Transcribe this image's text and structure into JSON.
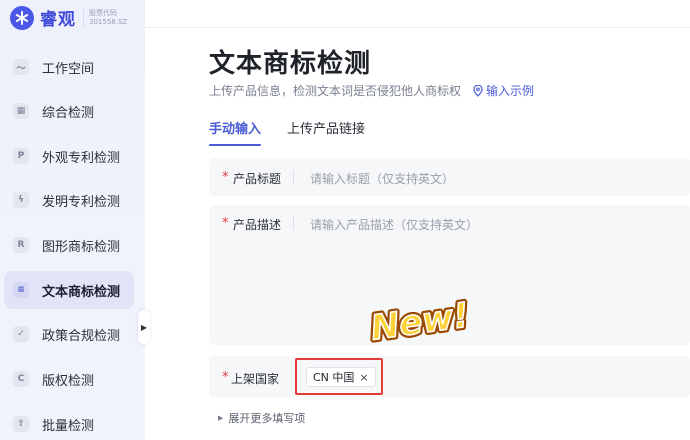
{
  "brand": {
    "name": "睿观",
    "stock_label": "股票代码",
    "stock_code": "301558.SZ"
  },
  "sidebar": {
    "items": [
      {
        "label": "工作空间",
        "icon": "workspace-icon",
        "glyph": "〜"
      },
      {
        "label": "综合检测",
        "icon": "grid-icon",
        "glyph": "▦"
      },
      {
        "label": "外观专利检测",
        "icon": "letter-p-icon",
        "glyph": "P"
      },
      {
        "label": "发明专利检测",
        "icon": "bulb-icon",
        "glyph": "ϟ"
      },
      {
        "label": "图形商标检测",
        "icon": "letter-r-icon",
        "glyph": "R"
      },
      {
        "label": "文本商标检测",
        "icon": "text-doc-icon",
        "glyph": "≡",
        "active": true
      },
      {
        "label": "政策合规检测",
        "icon": "check-icon",
        "glyph": "✓"
      },
      {
        "label": "版权检测",
        "icon": "copyright-icon",
        "glyph": "C"
      },
      {
        "label": "批量检测",
        "icon": "batch-upload-icon",
        "glyph": "⇪"
      }
    ]
  },
  "page": {
    "title": "文本商标检测",
    "subtitle": "上传产品信息，检测文本词是否侵犯他人商标权",
    "example_link": "输入示例"
  },
  "tabs": [
    {
      "label": "手动输入",
      "active": true
    },
    {
      "label": "上传产品链接",
      "active": false
    }
  ],
  "form": {
    "required_mark": "*",
    "title_label": "产品标题",
    "title_placeholder": "请输入标题（仅支持英文）",
    "desc_label": "产品描述",
    "desc_placeholder": "请输入产品描述（仅支持英文）",
    "country_label": "上架国家",
    "country_chip": "CN 中国",
    "chip_close": "×",
    "expand_more": "展开更多填写项"
  },
  "badge": {
    "text": "New!"
  },
  "colors": {
    "accent": "#4a5bd4",
    "required": "#e23b3b",
    "highlight_border": "#e23b3b"
  }
}
